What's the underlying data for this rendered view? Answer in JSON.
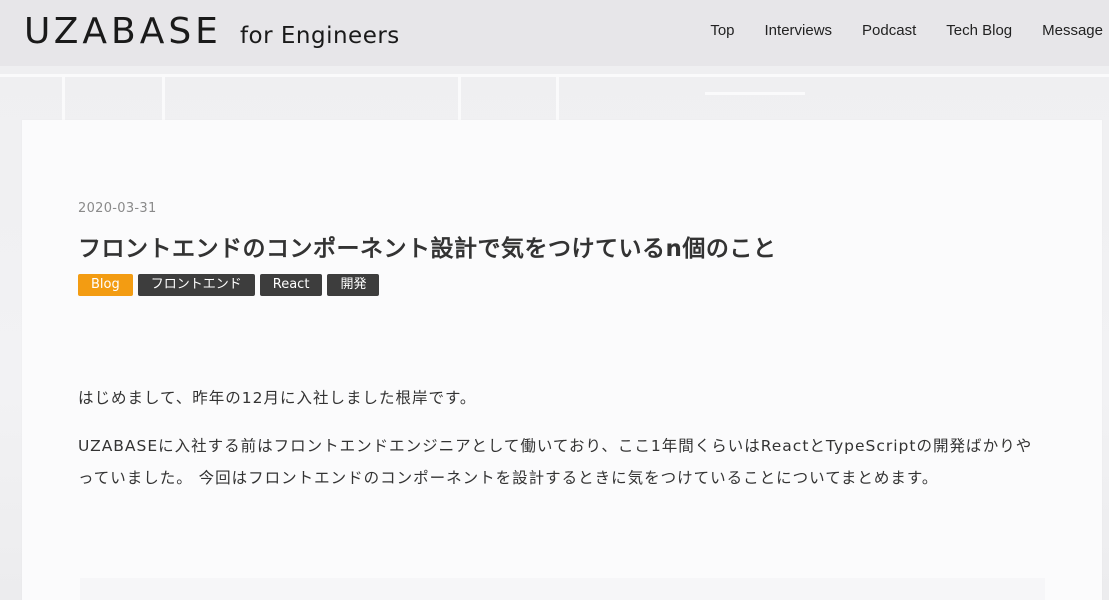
{
  "header": {
    "logo_main": "UZABASE",
    "logo_sub": "for Engineers",
    "nav": [
      "Top",
      "Interviews",
      "Podcast",
      "Tech Blog",
      "Message"
    ]
  },
  "article": {
    "date": "2020-03-31",
    "title": "フロントエンドのコンポーネント設計で気をつけているn個のこと",
    "tags": [
      {
        "label": "Blog",
        "color": "#f39c12"
      },
      {
        "label": "フロントエンド",
        "color": "#3d3d3d"
      },
      {
        "label": "React",
        "color": "#3d3d3d"
      },
      {
        "label": "開発",
        "color": "#3d3d3d"
      }
    ],
    "paragraphs": [
      "はじめまして、昨年の12月に入社しました根岸です。",
      "UZABASEに入社する前はフロントエンドエンジニアとして働いており、ここ1年間くらいはReactとTypeScriptの開発ばかりやっていました。 今回はフロントエンドのコンポーネントを設計するときに気をつけていることについてまとめます。"
    ]
  },
  "colors": {
    "header_bg": "#e7e6e9",
    "accent": "#f39c12",
    "tag_dark": "#3d3d3d"
  }
}
